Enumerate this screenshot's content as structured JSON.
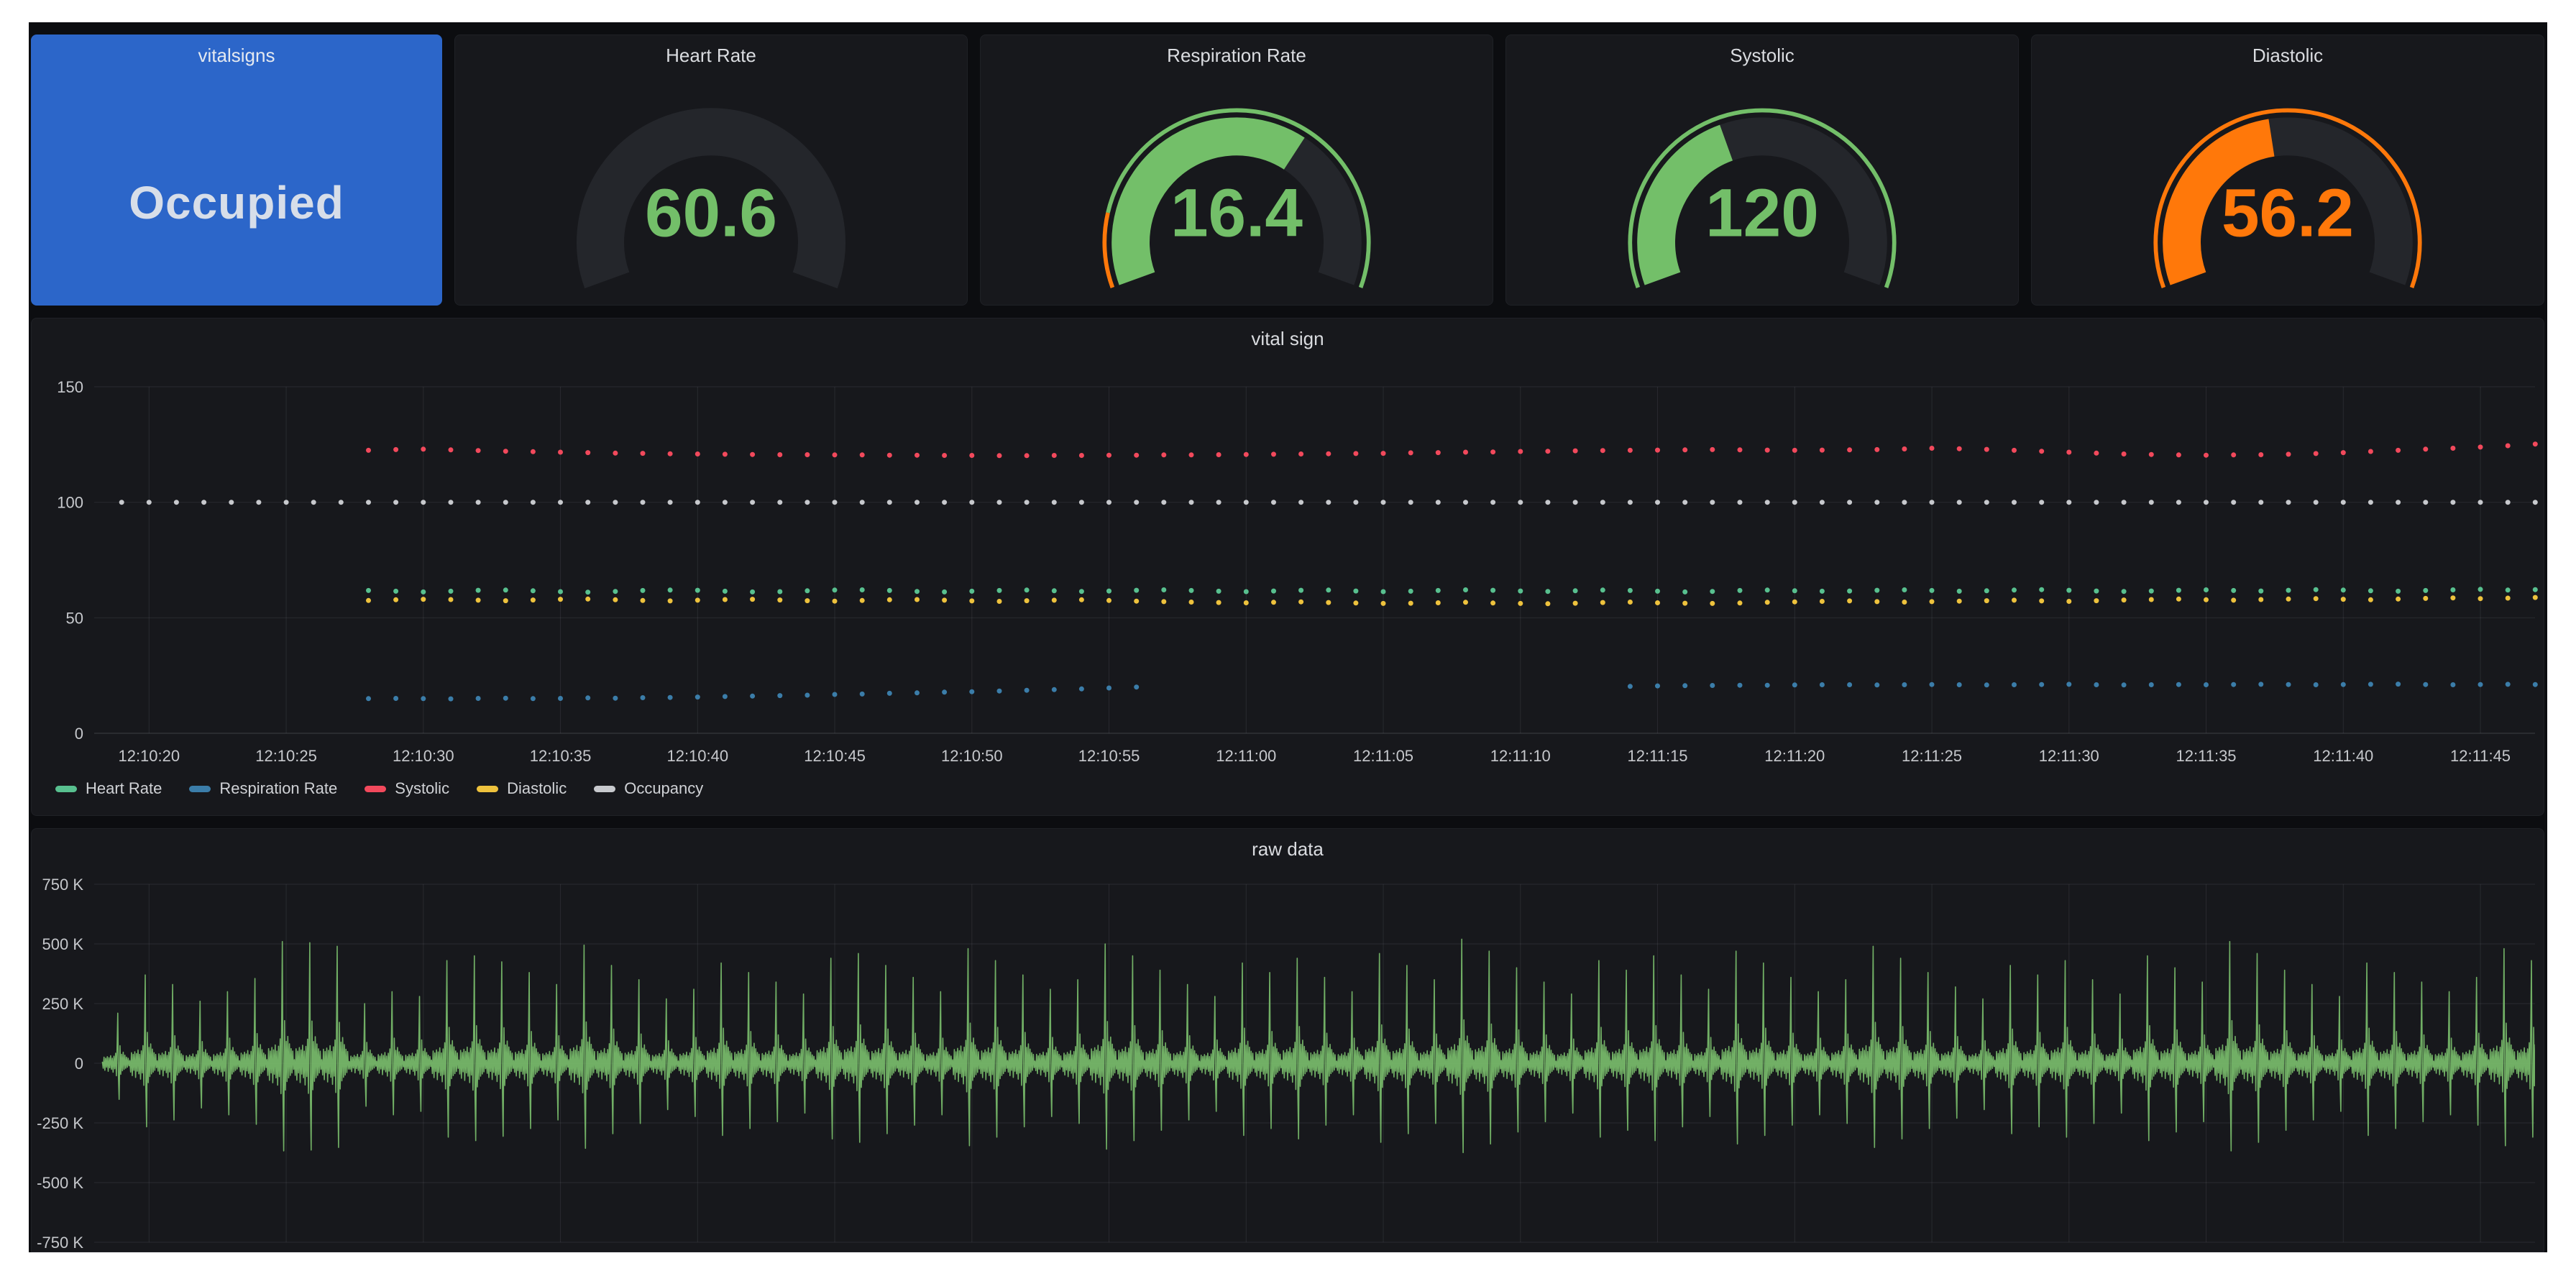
{
  "colors": {
    "page_bg": "#ffffff",
    "dashboard_bg": "#0C0D10",
    "panel_bg": "#17181C",
    "panel_border": "#1F2126",
    "title": "#DADCE0",
    "axis_text": "#C6C8CC",
    "grid": "rgba(204,204,220,0.10)",
    "axis_line": "rgba(204,204,220,0.22)",
    "gauge_track": "#24262B",
    "green": "#73BF69",
    "orange": "#FF780A",
    "stat_blue": "#2C66C9"
  },
  "stat_panel": {
    "title": "vitalsigns",
    "value": "Occupied"
  },
  "gauges": [
    {
      "title": "Heart Rate",
      "value": "60.6",
      "value_color": "#73BF69",
      "single_arc": true,
      "fill_fraction": 0,
      "fill_color": null,
      "ring": []
    },
    {
      "title": "Respiration Rate",
      "value": "16.4",
      "value_color": "#73BF69",
      "single_arc": false,
      "fill_fraction": 0.65,
      "fill_color": "#73BF69",
      "ring": [
        {
          "color": "#FF780A",
          "to": 0.15
        },
        {
          "color": "#73BF69",
          "to": 1
        }
      ]
    },
    {
      "title": "Systolic",
      "value": "120",
      "value_color": "#73BF69",
      "single_arc": false,
      "fill_fraction": 0.41,
      "fill_color": "#73BF69",
      "ring": [
        {
          "color": "#73BF69",
          "to": 1
        }
      ]
    },
    {
      "title": "Diastolic",
      "value": "56.2",
      "value_color": "#FF780A",
      "single_arc": false,
      "fill_fraction": 0.46,
      "fill_color": "#FF780A",
      "ring": [
        {
          "color": "#FF780A",
          "to": 1
        }
      ]
    }
  ],
  "chart_data": [
    {
      "type": "scatter",
      "title": "vital sign",
      "ylim": [
        0,
        150
      ],
      "yticks": [
        0,
        50,
        100,
        150
      ],
      "x_domain_s": [
        0,
        89
      ],
      "x_tick_start_s": 2,
      "x_tick_step_s": 5,
      "x_tick_labels": [
        "12:10:20",
        "12:10:25",
        "12:10:30",
        "12:10:35",
        "12:10:40",
        "12:10:45",
        "12:10:50",
        "12:10:55",
        "12:11:00",
        "12:11:05",
        "12:11:10",
        "12:11:15",
        "12:11:20",
        "12:11:25",
        "12:11:30",
        "12:11:35",
        "12:11:40",
        "12:11:45"
      ],
      "grid": true,
      "legend_position": "bottom",
      "series": [
        {
          "name": "Heart Rate",
          "color": "#58C08F",
          "segments": [
            {
              "start_s": 10,
              "interval_s": 1,
              "values": [
                61.8,
                61.5,
                61.2,
                61.5,
                61.9,
                62.0,
                61.7,
                61.3,
                61.1,
                61.4,
                61.8,
                62.0,
                61.9,
                61.5,
                61.2,
                61.3,
                61.7,
                62.0,
                62.1,
                61.8,
                61.4,
                61.2,
                61.5,
                61.8,
                62.0,
                61.7,
                61.4,
                61.6,
                61.9,
                62.1,
                61.8,
                61.5,
                61.3,
                61.6,
                61.9,
                62.0,
                61.6,
                61.3,
                61.5,
                61.8,
                62.1,
                61.9,
                61.6,
                61.4,
                61.7,
                62.0,
                61.8,
                61.5,
                61.2,
                61.4,
                61.8,
                62.0,
                61.7,
                61.5,
                61.6,
                61.9,
                62.1,
                61.8,
                61.5,
                61.7,
                62.0,
                62.2,
                61.9,
                61.6,
                61.4,
                61.6,
                61.9,
                62.1,
                61.8,
                61.6,
                61.9,
                62.2,
                62.0,
                61.7,
                61.5,
                61.8,
                62.1,
                62.3,
                62.0,
                62.2
              ]
            }
          ]
        },
        {
          "name": "Respiration Rate",
          "color": "#3B7DA9",
          "segments": [
            {
              "start_s": 10,
              "interval_s": 1,
              "values": [
                15.0,
                15.1,
                15.0,
                14.9,
                15.1,
                15.2,
                15.0,
                15.1,
                15.3,
                15.2,
                15.4,
                15.5,
                15.7,
                15.9,
                16.1,
                16.3,
                16.5,
                16.8,
                17.0,
                17.3,
                17.5,
                17.8,
                18.0,
                18.3,
                18.6,
                18.9,
                19.2,
                19.6,
                20.0
              ]
            },
            {
              "start_s": 56,
              "interval_s": 1,
              "values": [
                20.3,
                20.5,
                20.6,
                20.7,
                20.8,
                20.8,
                20.9,
                21.0,
                21.0,
                20.9,
                21.0,
                21.1,
                21.0,
                20.9,
                21.0,
                21.1,
                21.2,
                21.0,
                20.9,
                21.0,
                21.1,
                21.0,
                21.1,
                21.2,
                21.1,
                21.0,
                21.1,
                21.2,
                21.3,
                21.1,
                21.0,
                21.1,
                21.2,
                21.1
              ]
            }
          ]
        },
        {
          "name": "Systolic",
          "color": "#F2495C",
          "segments": [
            {
              "start_s": 10,
              "interval_s": 1,
              "values": [
                122.5,
                122.8,
                123.0,
                122.7,
                122.4,
                122.1,
                121.9,
                121.7,
                121.5,
                121.3,
                121.2,
                121.0,
                120.9,
                120.8,
                120.7,
                120.6,
                120.6,
                120.5,
                120.5,
                120.4,
                120.4,
                120.3,
                120.3,
                120.2,
                120.2,
                120.3,
                120.3,
                120.4,
                120.4,
                120.5,
                120.5,
                120.6,
                120.7,
                120.8,
                120.9,
                121.0,
                121.1,
                121.2,
                121.4,
                121.5,
                121.7,
                121.8,
                122.0,
                122.1,
                122.3,
                122.4,
                122.5,
                122.6,
                122.7,
                122.8,
                122.7,
                122.6,
                122.5,
                122.6,
                122.7,
                122.8,
                123.1,
                123.4,
                123.2,
                122.9,
                122.5,
                122.1,
                121.7,
                121.3,
                120.9,
                120.7,
                120.5,
                120.4,
                120.5,
                120.6,
                120.8,
                121.1,
                121.5,
                122.0,
                122.5,
                123.0,
                123.4,
                123.9,
                124.5,
                125.2
              ]
            }
          ]
        },
        {
          "name": "Diastolic",
          "color": "#EEC23D",
          "segments": [
            {
              "start_s": 10,
              "interval_s": 1,
              "values": [
                57.5,
                57.8,
                58.0,
                57.9,
                57.6,
                57.4,
                57.7,
                58.0,
                58.1,
                57.8,
                57.5,
                57.3,
                57.6,
                57.9,
                58.0,
                57.7,
                57.4,
                57.2,
                57.5,
                57.8,
                57.9,
                57.6,
                57.3,
                57.1,
                57.4,
                57.6,
                57.8,
                57.5,
                57.2,
                57.0,
                56.8,
                56.6,
                56.5,
                56.7,
                56.9,
                56.6,
                56.4,
                56.2,
                56.3,
                56.5,
                56.7,
                56.4,
                56.2,
                56.1,
                56.3,
                56.6,
                56.8,
                56.5,
                56.3,
                56.2,
                56.4,
                56.7,
                56.9,
                57.1,
                57.3,
                57.0,
                56.8,
                57.0,
                57.2,
                57.4,
                57.6,
                57.3,
                57.1,
                57.4,
                57.7,
                57.9,
                58.1,
                57.8,
                57.6,
                57.9,
                58.1,
                58.3,
                58.0,
                57.8,
                58.1,
                58.4,
                58.6,
                58.3,
                58.5,
                58.8
              ]
            }
          ]
        },
        {
          "name": "Occupancy",
          "color": "#C7C9CD",
          "segments": [
            {
              "start_s": 1,
              "interval_s": 1,
              "constant": 100,
              "count": 89
            }
          ]
        }
      ]
    },
    {
      "type": "line",
      "title": "raw data",
      "color": "#7ABD6B",
      "ylim": [
        -750000,
        750000
      ],
      "ytick_labels": [
        "750 K",
        "500 K",
        "250 K",
        "0",
        "-250 K",
        "-500 K",
        "-750 K"
      ],
      "x_domain_s": [
        0,
        89
      ],
      "grid_tick_start_s": 2,
      "grid_tick_step_s": 5,
      "grid": true,
      "beat": {
        "period_s": 1,
        "start_s": 0.3,
        "neg_depth_rel": -0.72,
        "template": [
          [
            0.0,
            0.03
          ],
          [
            0.03,
            -0.1
          ],
          [
            0.06,
            0.12
          ],
          [
            0.09,
            -0.14
          ],
          [
            0.12,
            0.1
          ],
          [
            0.15,
            -0.08
          ],
          [
            0.18,
            0.13
          ],
          [
            0.21,
            -0.16
          ],
          [
            0.24,
            0.11
          ],
          [
            0.27,
            -0.09
          ],
          [
            0.3,
            0.15
          ],
          [
            0.33,
            -0.12
          ],
          [
            0.36,
            0.1
          ],
          [
            0.39,
            -0.18
          ],
          [
            0.42,
            0.14
          ],
          [
            0.45,
            -0.11
          ],
          [
            0.48,
            0.2
          ],
          [
            0.51,
            -0.25
          ],
          [
            0.54,
            0.42
          ],
          [
            0.56,
            1.0
          ],
          [
            0.585,
            -0.3
          ],
          [
            0.61,
            -0.72
          ],
          [
            0.64,
            0.35
          ],
          [
            0.67,
            -0.22
          ],
          [
            0.7,
            0.18
          ],
          [
            0.73,
            -0.15
          ],
          [
            0.76,
            0.22
          ],
          [
            0.79,
            -0.12
          ],
          [
            0.82,
            0.16
          ],
          [
            0.85,
            -0.1
          ],
          [
            0.88,
            0.12
          ],
          [
            0.91,
            -0.08
          ],
          [
            0.94,
            0.1
          ],
          [
            0.97,
            -0.05
          ]
        ],
        "peaks_k": [
          210,
          370,
          330,
          260,
          300,
          355,
          510,
          505,
          490,
          250,
          300,
          280,
          430,
          450,
          425,
          380,
          330,
          495,
          410,
          350,
          270,
          310,
          420,
          380,
          340,
          290,
          440,
          460,
          410,
          360,
          300,
          480,
          430,
          370,
          310,
          350,
          500,
          450,
          390,
          330,
          280,
          420,
          380,
          440,
          360,
          300,
          460,
          410,
          350,
          520,
          470,
          400,
          340,
          290,
          430,
          390,
          450,
          370,
          310,
          470,
          420,
          360,
          300,
          350,
          490,
          440,
          380,
          320,
          270,
          410,
          370,
          430,
          350,
          290,
          450,
          400,
          340,
          510,
          460,
          390,
          330,
          280,
          420,
          380,
          340,
          300,
          360,
          480,
          430
        ]
      }
    }
  ]
}
